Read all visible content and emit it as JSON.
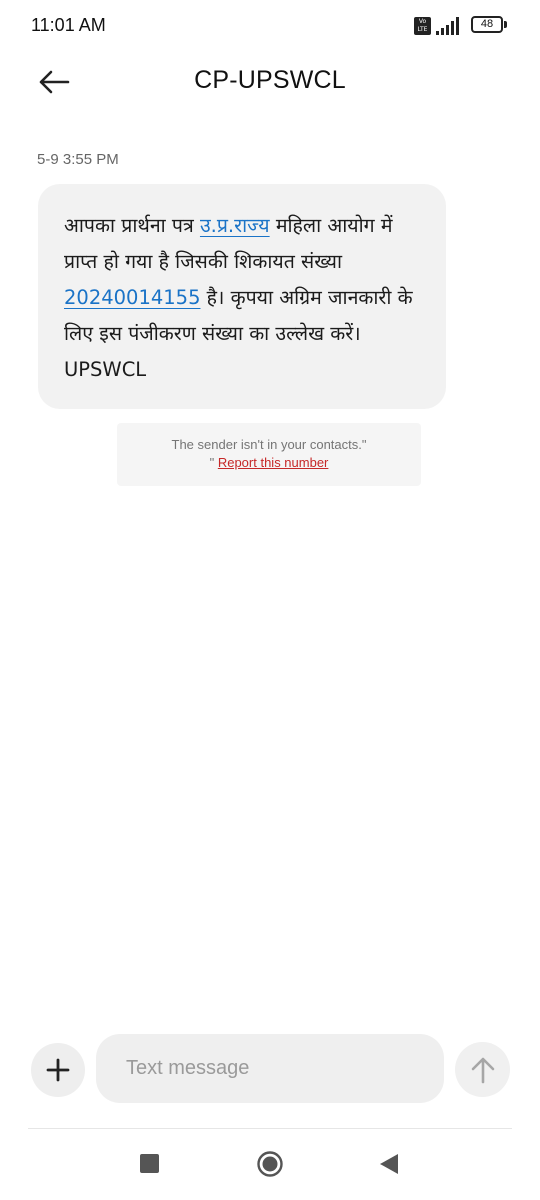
{
  "status_bar": {
    "time": "11:01 AM",
    "volte_label": "Vo LTE",
    "battery_level": "48",
    "icons": [
      "volte-icon",
      "signal-icon",
      "battery-icon"
    ]
  },
  "header": {
    "title": "CP-UPSWCL",
    "back_icon": "back-arrow-icon"
  },
  "conversation": {
    "timestamp": "5-9 3:55 PM",
    "message": {
      "part1": "आपका प्रार्थना पत्र ",
      "link1": "उ.प्र.राज्य",
      "part2": " महिला आयोग में प्राप्त हो गया है जिसकी शिकायत संख्या ",
      "link2": "20240014155",
      "part3": "  है। कृपया अग्रिम जानकारी के लिए इस पंजीकरण संख्या का उल्लेख करें। UPSWCL"
    },
    "notice": {
      "text": "The sender isn't in your contacts.\"",
      "quote_prefix": "\" ",
      "report_link": "Report this number"
    }
  },
  "compose": {
    "add_icon": "plus-icon",
    "placeholder": "Text message",
    "send_icon": "send-arrow-icon"
  },
  "nav_bar": {
    "icons": [
      "recents-square-icon",
      "home-circle-icon",
      "back-triangle-icon"
    ]
  },
  "colors": {
    "link": "#1a73c7",
    "report": "#c62828",
    "bubble": "#f2f2f2"
  }
}
